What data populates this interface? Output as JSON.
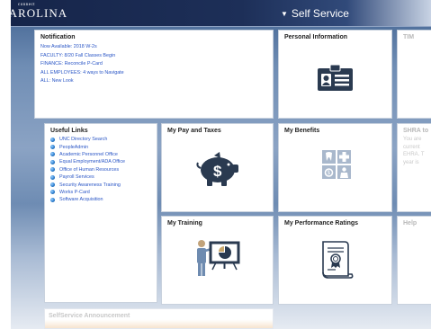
{
  "header": {
    "logo_small": "connect",
    "logo_main": "CAROLINA",
    "nav_arrow": "▼",
    "nav_title": "Self Service"
  },
  "tiles": {
    "notification": {
      "title": "Notification",
      "items": [
        "Now Available: 2018 W-2s",
        "FACULTY: 8/20 Fall Classes Begin",
        "FINANCE: Reconcile P-Card",
        "ALL EMPLOYEES: 4 ways to Navigate",
        "ALL: New Look"
      ]
    },
    "personal_info": {
      "title": "Personal Information",
      "icon": "id-card-icon"
    },
    "tim": {
      "title": "TIM"
    },
    "useful_links": {
      "title": "Useful Links",
      "items": [
        "UNC Directory Search",
        "PeopleAdmin",
        "Academic Personnel Office",
        "Equal Employment/ADA Office",
        "Office of Human Resources",
        "Payroll Services",
        "Security Awareness Training",
        "Works P-Card",
        "Software Acquisition"
      ]
    },
    "pay_taxes": {
      "title": "My Pay and Taxes",
      "icon": "piggy-bank-icon"
    },
    "benefits": {
      "title": "My Benefits",
      "icon": "benefits-icon"
    },
    "shra": {
      "title": "SHRA to",
      "lines": [
        "You are",
        "current",
        "EHRA. T",
        "year is"
      ]
    },
    "training": {
      "title": "My Training",
      "icon": "presenter-icon"
    },
    "performance": {
      "title": "My Performance Ratings",
      "icon": "certificate-icon"
    },
    "help": {
      "title": "Help"
    }
  },
  "announcement": {
    "title": "SelfService Announcement"
  },
  "colors": {
    "header_bg": "#16254a",
    "link": "#2a56c6",
    "icon_dark": "#2a3a50"
  }
}
